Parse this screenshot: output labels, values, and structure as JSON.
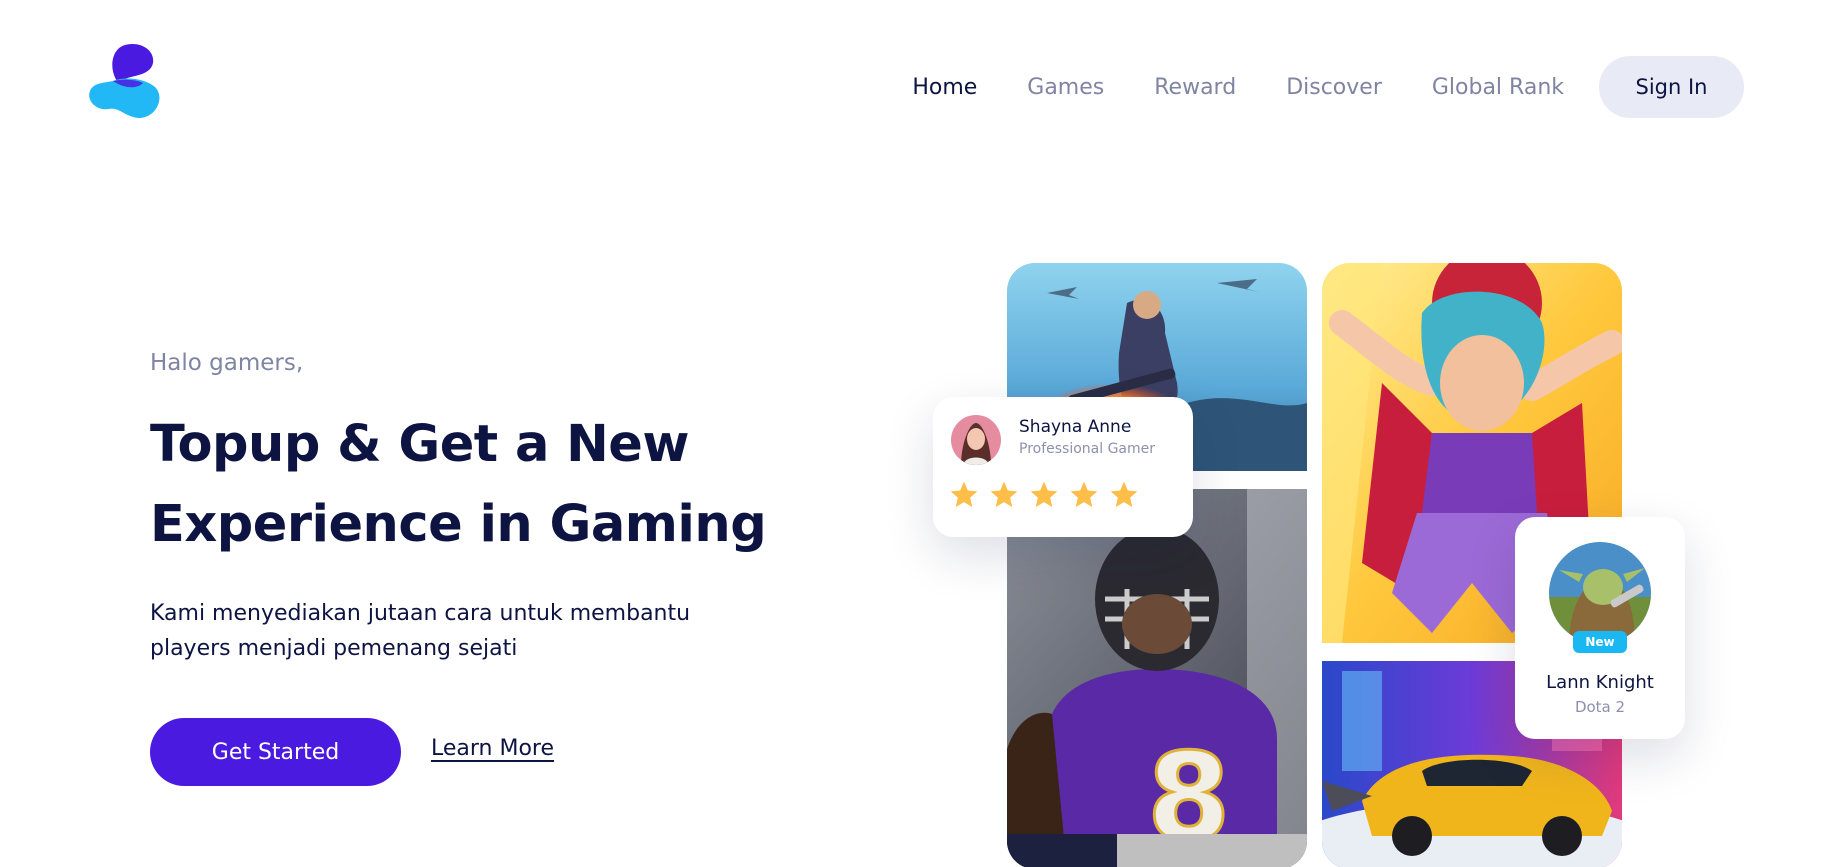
{
  "brand": {
    "logo_icon": "s-logo-icon",
    "colors": {
      "primary": "#4b1ae0",
      "accent": "#21b8f5",
      "dark": "#0d1441",
      "muted": "#7f84a3"
    }
  },
  "nav": {
    "links": [
      "Home",
      "Games",
      "Reward",
      "Discover",
      "Global Rank"
    ],
    "active": "Home",
    "signin_label": "Sign In"
  },
  "hero": {
    "greeting": "Halo gamers,",
    "headline": {
      "part1": "Topup & Get a ",
      "highlight1": "New",
      "highlight2": "Experience",
      "part2": " in Gaming"
    },
    "description": "Kami menyediakan jutaan cara untuk membantu players menjadi pemenang sejati",
    "primary_button": "Get Started",
    "secondary_link": "Learn More"
  },
  "gallery": {
    "images": [
      "battlefield-soldier-image",
      "football-player-image",
      "knockout-city-character-image",
      "need-for-speed-car-image"
    ]
  },
  "rating_card": {
    "name": "Shayna Anne",
    "role": "Professional Gamer",
    "rating": 5,
    "max_rating": 5
  },
  "new_card": {
    "badge": "New",
    "name": "Lann Knight",
    "game": "Dota 2"
  }
}
